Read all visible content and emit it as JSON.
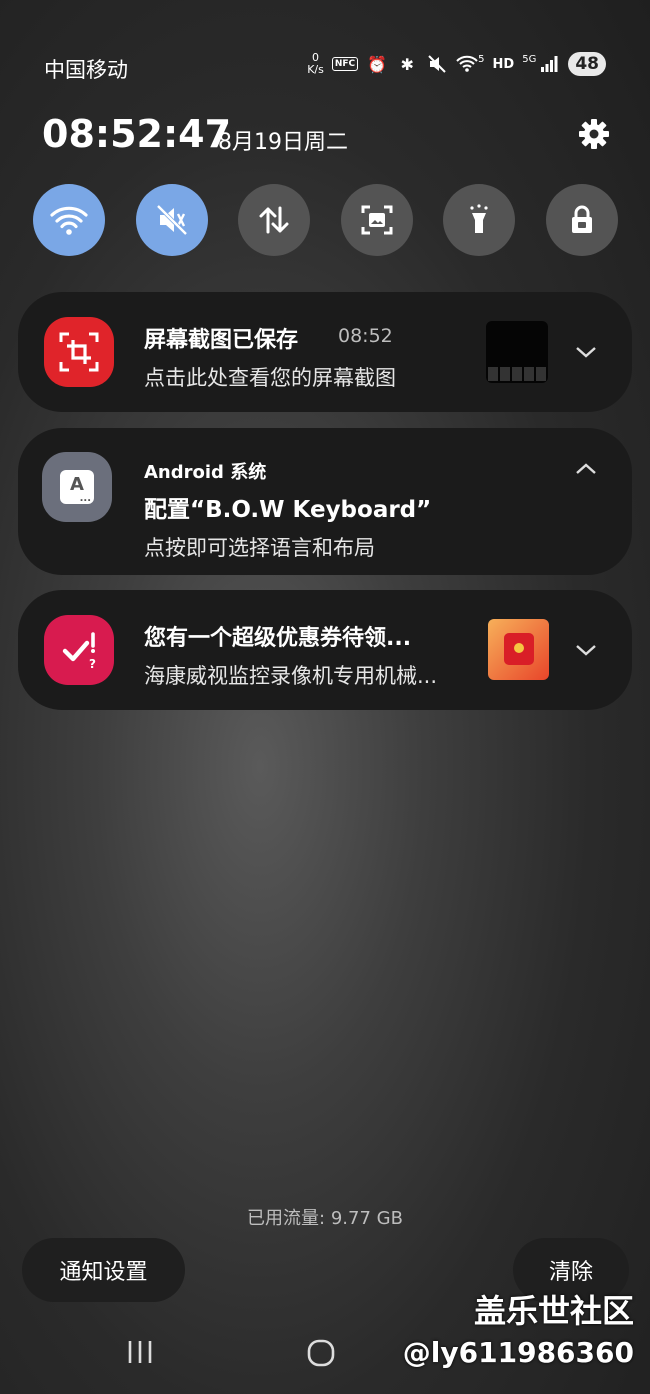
{
  "status_bar": {
    "carrier": "中国移动",
    "speed_value": "0",
    "speed_unit": "K/s",
    "nfc": "NFC",
    "network": "5G",
    "hd": "HD",
    "wifi_gen": "5",
    "battery": "48"
  },
  "header": {
    "time": "08:52:47",
    "date": "8月19日周二"
  },
  "quick_settings": [
    {
      "name": "wifi",
      "active": true
    },
    {
      "name": "mute",
      "active": true
    },
    {
      "name": "mobile-data",
      "active": false
    },
    {
      "name": "screenshot",
      "active": false
    },
    {
      "name": "flashlight",
      "active": false
    },
    {
      "name": "lock",
      "active": false
    }
  ],
  "notifications": [
    {
      "title": "屏幕截图已保存",
      "time": "08:52",
      "text": "点击此处查看您的屏幕截图",
      "icon": "screenshot-crop-icon",
      "color": "#e0242a"
    },
    {
      "app": "Android 系统",
      "title": "配置“B.O.W Keyboard”",
      "text": "点按即可选择语言和布局",
      "icon": "keyboard-a-icon",
      "color": "#6b6f7c"
    },
    {
      "title": "您有一个超级优惠券待领...",
      "text": "海康威视监控录像机专用机械...",
      "icon": "check-alert-icon",
      "color": "#d81b4f"
    }
  ],
  "footer": {
    "data_usage": "已用流量: 9.77 GB",
    "notification_settings": "通知设置",
    "clear": "清除"
  },
  "watermark": {
    "line1": "盖乐世社区",
    "line2": "@ly611986360"
  }
}
